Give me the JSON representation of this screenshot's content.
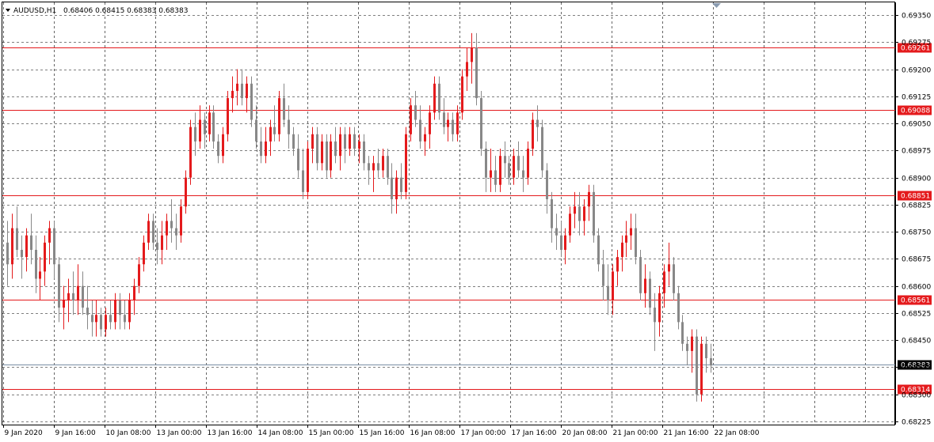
{
  "header": {
    "symbol": "AUDUSD,H1",
    "ohlc": "0.68406 0.68415 0.68383 0.68383"
  },
  "colors": {
    "bull": "#e41a1c",
    "bear": "#888888",
    "level_line": "#e41a1c",
    "grid": "#000000",
    "price_line": "#7a8fa6",
    "current_price_bg": "#000000",
    "level_label_bg": "#e41a1c"
  },
  "chart_data": {
    "type": "candlestick",
    "grid": true,
    "ylim": [
      0.68225,
      0.69375
    ],
    "y_ticks": [
      "0.69350",
      "0.69275",
      "0.69200",
      "0.69125",
      "0.69050",
      "0.68975",
      "0.68900",
      "0.68825",
      "0.68750",
      "0.68675",
      "0.68600",
      "0.68525",
      "0.68450",
      "0.68375",
      "0.68300",
      "0.68225"
    ],
    "x_labels": [
      "9 Jan 2020",
      "9 Jan 16:00",
      "10 Jan 08:00",
      "13 Jan 00:00",
      "13 Jan 16:00",
      "14 Jan 08:00",
      "15 Jan 00:00",
      "15 Jan 16:00",
      "16 Jan 08:00",
      "17 Jan 00:00",
      "17 Jan 16:00",
      "20 Jan 08:00",
      "21 Jan 00:00",
      "21 Jan 16:00",
      "22 Jan 08:00"
    ],
    "levels": [
      "0.69261",
      "0.69088",
      "0.68851",
      "0.68561",
      "0.68314"
    ],
    "current_price": "0.68383",
    "candles": [
      [
        0.6872,
        0.6878,
        0.686,
        0.6866
      ],
      [
        0.6866,
        0.688,
        0.6862,
        0.6876
      ],
      [
        0.6876,
        0.6882,
        0.6868,
        0.687
      ],
      [
        0.687,
        0.6874,
        0.6862,
        0.6868
      ],
      [
        0.6868,
        0.6876,
        0.6864,
        0.6874
      ],
      [
        0.6874,
        0.688,
        0.6866,
        0.687
      ],
      [
        0.687,
        0.6874,
        0.6858,
        0.6862
      ],
      [
        0.6862,
        0.6868,
        0.6856,
        0.6864
      ],
      [
        0.6864,
        0.6874,
        0.686,
        0.6872
      ],
      [
        0.6872,
        0.6878,
        0.6866,
        0.6876
      ],
      [
        0.6876,
        0.6878,
        0.6862,
        0.6866
      ],
      [
        0.6866,
        0.6868,
        0.685,
        0.6854
      ],
      [
        0.6854,
        0.686,
        0.6848,
        0.6856
      ],
      [
        0.6856,
        0.6862,
        0.685,
        0.6858
      ],
      [
        0.6858,
        0.6864,
        0.6852,
        0.6856
      ],
      [
        0.6856,
        0.6866,
        0.6852,
        0.686
      ],
      [
        0.686,
        0.6864,
        0.6852,
        0.6854
      ],
      [
        0.6854,
        0.686,
        0.6848,
        0.6852
      ],
      [
        0.6852,
        0.6856,
        0.6846,
        0.685
      ],
      [
        0.685,
        0.6856,
        0.6846,
        0.6852
      ],
      [
        0.6852,
        0.6854,
        0.6846,
        0.6848
      ],
      [
        0.6848,
        0.6854,
        0.6846,
        0.6852
      ],
      [
        0.6852,
        0.6856,
        0.6848,
        0.685
      ],
      [
        0.685,
        0.6858,
        0.6848,
        0.6856
      ],
      [
        0.6856,
        0.6858,
        0.6848,
        0.6852
      ],
      [
        0.6852,
        0.6856,
        0.6848,
        0.685
      ],
      [
        0.685,
        0.6858,
        0.6848,
        0.6856
      ],
      [
        0.6856,
        0.6862,
        0.6852,
        0.686
      ],
      [
        0.686,
        0.6868,
        0.6858,
        0.6866
      ],
      [
        0.6866,
        0.6874,
        0.6864,
        0.6872
      ],
      [
        0.6872,
        0.688,
        0.687,
        0.6878
      ],
      [
        0.6878,
        0.688,
        0.687,
        0.6872
      ],
      [
        0.6872,
        0.6876,
        0.6866,
        0.687
      ],
      [
        0.687,
        0.6878,
        0.6866,
        0.6874
      ],
      [
        0.6874,
        0.688,
        0.687,
        0.6878
      ],
      [
        0.6878,
        0.6884,
        0.6872,
        0.6876
      ],
      [
        0.6876,
        0.688,
        0.687,
        0.6874
      ],
      [
        0.6874,
        0.6884,
        0.6872,
        0.6882
      ],
      [
        0.6882,
        0.6892,
        0.688,
        0.689
      ],
      [
        0.689,
        0.6906,
        0.6888,
        0.6904
      ],
      [
        0.6904,
        0.6908,
        0.6896,
        0.69
      ],
      [
        0.69,
        0.691,
        0.6898,
        0.6906
      ],
      [
        0.6906,
        0.6908,
        0.6898,
        0.6902
      ],
      [
        0.6902,
        0.691,
        0.69,
        0.6908
      ],
      [
        0.6908,
        0.691,
        0.6898,
        0.69
      ],
      [
        0.69,
        0.6902,
        0.6894,
        0.6896
      ],
      [
        0.6896,
        0.6904,
        0.6894,
        0.6902
      ],
      [
        0.6902,
        0.6914,
        0.69,
        0.6912
      ],
      [
        0.6912,
        0.6918,
        0.6908,
        0.6914
      ],
      [
        0.6914,
        0.692,
        0.691,
        0.6916
      ],
      [
        0.6916,
        0.692,
        0.691,
        0.6912
      ],
      [
        0.6912,
        0.6918,
        0.6908,
        0.6916
      ],
      [
        0.6916,
        0.6918,
        0.6904,
        0.6906
      ],
      [
        0.6906,
        0.691,
        0.6898,
        0.69
      ],
      [
        0.69,
        0.6904,
        0.6894,
        0.6896
      ],
      [
        0.6896,
        0.6904,
        0.6894,
        0.69
      ],
      [
        0.69,
        0.6906,
        0.6896,
        0.6904
      ],
      [
        0.6904,
        0.691,
        0.69,
        0.6902
      ],
      [
        0.6902,
        0.6914,
        0.69,
        0.6912
      ],
      [
        0.6912,
        0.6916,
        0.6904,
        0.6906
      ],
      [
        0.6906,
        0.691,
        0.6898,
        0.6902
      ],
      [
        0.6902,
        0.6904,
        0.6896,
        0.6898
      ],
      [
        0.6898,
        0.6902,
        0.689,
        0.6892
      ],
      [
        0.6892,
        0.6898,
        0.6884,
        0.6886
      ],
      [
        0.6886,
        0.69,
        0.6884,
        0.6898
      ],
      [
        0.6898,
        0.6904,
        0.6894,
        0.6902
      ],
      [
        0.6902,
        0.6904,
        0.6892,
        0.6894
      ],
      [
        0.6894,
        0.6902,
        0.6892,
        0.69
      ],
      [
        0.69,
        0.6902,
        0.689,
        0.6892
      ],
      [
        0.6892,
        0.6902,
        0.689,
        0.69
      ],
      [
        0.69,
        0.6904,
        0.6894,
        0.6896
      ],
      [
        0.6896,
        0.6904,
        0.6892,
        0.6902
      ],
      [
        0.6902,
        0.6904,
        0.6894,
        0.6898
      ],
      [
        0.6898,
        0.6904,
        0.6896,
        0.6902
      ],
      [
        0.6902,
        0.6904,
        0.6896,
        0.6898
      ],
      [
        0.6898,
        0.6902,
        0.6894,
        0.69
      ],
      [
        0.69,
        0.6902,
        0.6892,
        0.6894
      ],
      [
        0.6894,
        0.6896,
        0.6888,
        0.6892
      ],
      [
        0.6892,
        0.6896,
        0.6886,
        0.6894
      ],
      [
        0.6894,
        0.6898,
        0.689,
        0.6892
      ],
      [
        0.6892,
        0.6898,
        0.689,
        0.6896
      ],
      [
        0.6896,
        0.6898,
        0.6888,
        0.689
      ],
      [
        0.689,
        0.6894,
        0.688,
        0.6884
      ],
      [
        0.6884,
        0.6892,
        0.688,
        0.689
      ],
      [
        0.689,
        0.6894,
        0.6884,
        0.6886
      ],
      [
        0.6886,
        0.6904,
        0.6884,
        0.6902
      ],
      [
        0.6902,
        0.6912,
        0.69,
        0.691
      ],
      [
        0.691,
        0.6914,
        0.6904,
        0.6906
      ],
      [
        0.6906,
        0.691,
        0.6898,
        0.69
      ],
      [
        0.69,
        0.6904,
        0.6896,
        0.6902
      ],
      [
        0.6902,
        0.691,
        0.6898,
        0.6908
      ],
      [
        0.6908,
        0.6918,
        0.6906,
        0.6916
      ],
      [
        0.6916,
        0.6918,
        0.6906,
        0.6908
      ],
      [
        0.6908,
        0.6912,
        0.6902,
        0.6904
      ],
      [
        0.6904,
        0.6908,
        0.69,
        0.6906
      ],
      [
        0.6906,
        0.6908,
        0.69,
        0.6902
      ],
      [
        0.6902,
        0.691,
        0.69,
        0.6908
      ],
      [
        0.6908,
        0.692,
        0.6906,
        0.6918
      ],
      [
        0.6918,
        0.6926,
        0.6914,
        0.6922
      ],
      [
        0.6922,
        0.693,
        0.6916,
        0.6926
      ],
      [
        0.6926,
        0.693,
        0.691,
        0.6912
      ],
      [
        0.6912,
        0.6914,
        0.6896,
        0.6898
      ],
      [
        0.6898,
        0.69,
        0.6886,
        0.689
      ],
      [
        0.689,
        0.6898,
        0.6886,
        0.6892
      ],
      [
        0.6892,
        0.6896,
        0.6886,
        0.6888
      ],
      [
        0.6888,
        0.6898,
        0.6886,
        0.6896
      ],
      [
        0.6896,
        0.69,
        0.689,
        0.6894
      ],
      [
        0.6894,
        0.6896,
        0.6888,
        0.689
      ],
      [
        0.689,
        0.6898,
        0.6888,
        0.6896
      ],
      [
        0.6896,
        0.69,
        0.689,
        0.6892
      ],
      [
        0.6892,
        0.6896,
        0.6886,
        0.689
      ],
      [
        0.689,
        0.69,
        0.6888,
        0.6898
      ],
      [
        0.6898,
        0.6908,
        0.6896,
        0.6906
      ],
      [
        0.6906,
        0.691,
        0.69,
        0.6904
      ],
      [
        0.6904,
        0.6906,
        0.689,
        0.6892
      ],
      [
        0.6892,
        0.6894,
        0.688,
        0.6884
      ],
      [
        0.6884,
        0.6886,
        0.6872,
        0.6876
      ],
      [
        0.6876,
        0.688,
        0.687,
        0.6874
      ],
      [
        0.6874,
        0.6878,
        0.6868,
        0.687
      ],
      [
        0.687,
        0.6876,
        0.6866,
        0.6874
      ],
      [
        0.6874,
        0.6882,
        0.6872,
        0.688
      ],
      [
        0.688,
        0.6886,
        0.6876,
        0.6882
      ],
      [
        0.6882,
        0.6886,
        0.6874,
        0.6878
      ],
      [
        0.6878,
        0.6884,
        0.6874,
        0.6882
      ],
      [
        0.6882,
        0.6888,
        0.6878,
        0.6886
      ],
      [
        0.6886,
        0.6888,
        0.6872,
        0.6874
      ],
      [
        0.6874,
        0.6876,
        0.6864,
        0.6866
      ],
      [
        0.6866,
        0.687,
        0.6856,
        0.686
      ],
      [
        0.686,
        0.6866,
        0.6852,
        0.6856
      ],
      [
        0.6856,
        0.6866,
        0.6852,
        0.6864
      ],
      [
        0.6864,
        0.687,
        0.686,
        0.6868
      ],
      [
        0.6868,
        0.6874,
        0.6864,
        0.6872
      ],
      [
        0.6872,
        0.6878,
        0.6868,
        0.6874
      ],
      [
        0.6874,
        0.688,
        0.687,
        0.6876
      ],
      [
        0.6876,
        0.688,
        0.6866,
        0.6868
      ],
      [
        0.6868,
        0.687,
        0.6856,
        0.6858
      ],
      [
        0.6858,
        0.6866,
        0.6854,
        0.6862
      ],
      [
        0.6862,
        0.6864,
        0.6852,
        0.6854
      ],
      [
        0.6854,
        0.6858,
        0.6842,
        0.685
      ],
      [
        0.685,
        0.686,
        0.6846,
        0.6858
      ],
      [
        0.6858,
        0.6866,
        0.6854,
        0.6864
      ],
      [
        0.6864,
        0.6872,
        0.686,
        0.6866
      ],
      [
        0.6866,
        0.6868,
        0.6856,
        0.6858
      ],
      [
        0.6858,
        0.686,
        0.6848,
        0.685
      ],
      [
        0.685,
        0.6852,
        0.6842,
        0.6844
      ],
      [
        0.6844,
        0.6846,
        0.6838,
        0.6842
      ],
      [
        0.6842,
        0.6848,
        0.6836,
        0.6846
      ],
      [
        0.6846,
        0.6848,
        0.6828,
        0.683
      ],
      [
        0.683,
        0.6846,
        0.6828,
        0.6844
      ],
      [
        0.6844,
        0.6846,
        0.6836,
        0.684
      ],
      [
        0.684,
        0.6844,
        0.6836,
        0.6838
      ]
    ]
  }
}
